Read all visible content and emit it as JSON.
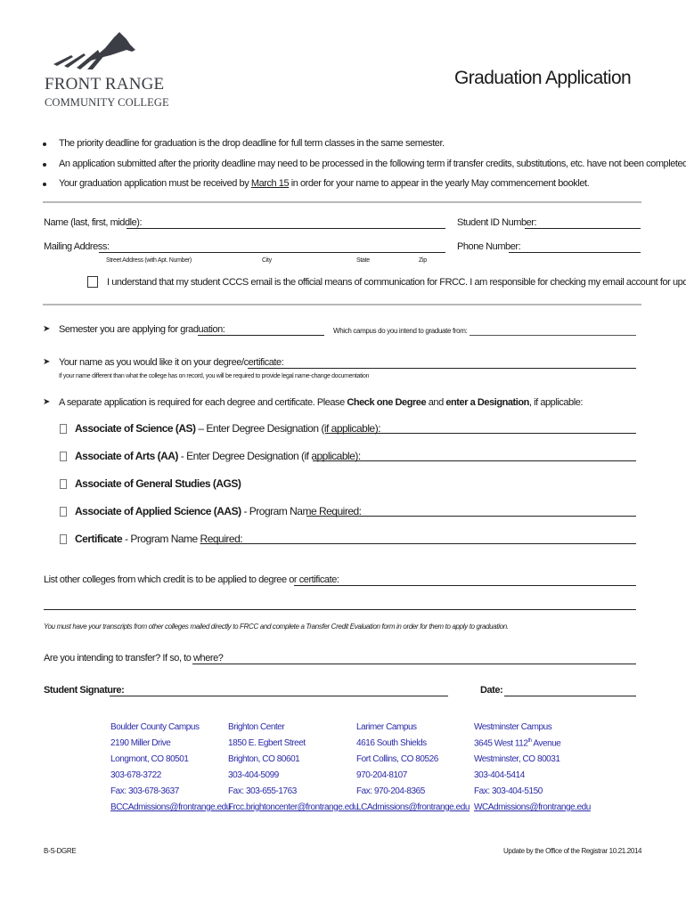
{
  "logo": {
    "line1": "FRONT RANGE",
    "line2": "COMMUNITY COLLEGE",
    "icon": "mountain-logo-icon"
  },
  "title": "Graduation Application",
  "bullets": [
    "The priority deadline for graduation is the drop deadline for full term classes in the same semester.",
    "An application submitted after the priority deadline may need to be processed in the following term if transfer credits, substitutions, etc. have not been completed.",
    {
      "before": "Your graduation application must be received by ",
      "underlined": "March 15",
      "after": " in order for your name to appear in the yearly May commencement booklet."
    }
  ],
  "fields": {
    "name_label": "Name (last, first, middle):",
    "name_value": "",
    "student_id_label": "Student ID Number:",
    "student_id_value": "",
    "mailing_label": "Mailing Address:",
    "mailing_value": "",
    "phone_label": "Phone Number:",
    "phone_value": "",
    "address_sublabels": [
      "Street Address (with Apt. Number)",
      "City",
      "State",
      "Zip"
    ]
  },
  "email_ack": {
    "checked": false,
    "text": "I understand that my student CCCS email is the official means of communication for FRCC.  I am responsible for checking my email account for updates."
  },
  "semester": {
    "label": "Semester you are applying for graduation:",
    "value": "",
    "campus_label": "Which campus do you intend to graduate from:",
    "campus_value": ""
  },
  "diploma_name": {
    "label": "Your name as you would like it on your degree/certificate:",
    "value": "",
    "note": "If your name different than what the college has on record, you will be required to provide legal name-change documentation"
  },
  "degree_intro": {
    "before": "A separate application is required for each degree and certificate.  Please ",
    "bold1": "Check one Degree",
    "mid": " and ",
    "bold2": "enter a Designation",
    "after": ", if applicable:"
  },
  "degrees": [
    {
      "name": "Associate of Science (AS)",
      "suffix": " – Enter Degree Designation (if applicable):",
      "required": "",
      "after": "",
      "checked": false,
      "value": ""
    },
    {
      "name": "Associate of Arts (AA)",
      "suffix": " -  Enter Degree Designation (if applicable):",
      "required": "",
      "after": "",
      "checked": false,
      "value": ""
    },
    {
      "name": "Associate of General Studies (AGS)",
      "suffix": "",
      "required": "",
      "after": "",
      "checked": false,
      "value": ""
    },
    {
      "name": "Associate of Applied Science (AAS)",
      "suffix": " - Program Name ",
      "required": "Required",
      "after": ":",
      "checked": false,
      "value": ""
    },
    {
      "name": "Certificate",
      "suffix": " - Program Name ",
      "required": "Required",
      "after": ":",
      "checked": false,
      "value": ""
    }
  ],
  "other_colleges": {
    "label": "List other colleges from which credit is to be applied to degree or certificate:",
    "value": "",
    "note": "You must have your transcripts from other colleges mailed directly to FRCC and complete a Transfer Credit Evaluation form in order for them to apply to graduation."
  },
  "transfer": {
    "label": "Are you intending to transfer? If so, to where?",
    "value": ""
  },
  "signature": {
    "label": "Student Signature:",
    "date_label": "Date:"
  },
  "campuses": [
    {
      "name": "Boulder County Campus",
      "street": "2190 Miller Drive",
      "city": "Longmont, CO 80501",
      "phone": "303-678-3722",
      "fax": "Fax:  303-678-3637",
      "email": "BCCAdmissions@frontrange.edu"
    },
    {
      "name": "Brighton Center",
      "street": "1850 E. Egbert Street",
      "city": "Brighton, CO 80601",
      "phone": "303-404-5099",
      "fax": "Fax: 303-655-1763",
      "email": "Frcc.brightoncenter@frontrange.edu"
    },
    {
      "name": "Larimer Campus",
      "street": "4616 South Shields",
      "city": "Fort Collins, CO 80526",
      "phone": "970-204-8107",
      "fax": "Fax: 970-204-8365",
      "email": "LCAdmissions@frontrange.edu"
    },
    {
      "name": "Westminster Campus",
      "street_pre": "3645 West 112",
      "street_sup": "th",
      "street_post": " Avenue",
      "city": "Westminster, CO 80031",
      "phone": "303-404-5414",
      "fax": "Fax: 303-404-5150",
      "email": "WCAdmissions@frontrange.edu"
    }
  ],
  "footer": {
    "code": "B-S-DGRE",
    "updated": "Update by the Office of the Registrar 10.21.2014"
  },
  "colors": {
    "logo": "#3b3e44",
    "campus_text": "#2a2aa8",
    "rule": "#b8b8b8"
  }
}
